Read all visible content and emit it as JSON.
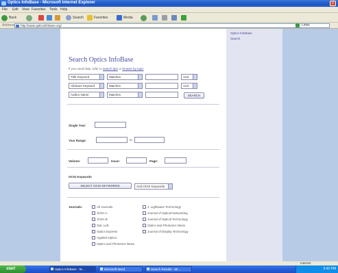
{
  "window": {
    "title": "Optics InfoBase - Microsoft Internet Explorer",
    "close_glyph": "x"
  },
  "menu": [
    "File",
    "Edit",
    "View",
    "Favorites",
    "Tools",
    "Help"
  ],
  "toolbar": {
    "back": "Back",
    "search": "Search",
    "favorites": "Favorites",
    "media": "Media"
  },
  "address": {
    "label": "Address",
    "url": "http://www.opticsinfobase.org/",
    "links": "Links"
  },
  "sidebar": {
    "items": [
      "Optics InfoBase",
      "Search"
    ]
  },
  "search": {
    "title": "Search Optics InfoBase",
    "intro_prefix": "If you need help, refer to ",
    "intro_link1": "search tips",
    "intro_mid": " or ",
    "intro_link2": "browse by topic",
    "rows": [
      {
        "field": "Title Keyword",
        "match": "Matches",
        "op": "And"
      },
      {
        "field": "Abstract Keyword",
        "match": "Matches",
        "op": "And"
      },
      {
        "field": "Author Name",
        "match": "Matches",
        "op": ""
      }
    ],
    "search_button": "SEARCH",
    "single_year_label": "Single Year:",
    "year_range_label": "Year Range:",
    "year_range_to": "to",
    "volume_label": "Volume:",
    "issue_label": "Issue:",
    "page_label": "Page:",
    "ocis_label": "OCIS Keywords",
    "ocis_button": "SELECT OCIS KEYWORDS",
    "ocis_select": "And OCIS Keywords",
    "journals_label": "Journals:",
    "journals_col1": [
      "All Journals",
      "JOSA A",
      "JOSA B",
      "Opt. Lett.",
      "Optics Express",
      "Applied Optics",
      "Optics and Photonics News"
    ],
    "journals_col2": [
      "J. Lightwave Technology",
      "Journal of Optical Networking",
      "Journal of Optical Technology",
      "Optics and Photonics News",
      "Journal of Display Technology"
    ]
  },
  "status": {
    "zone": "Internet"
  },
  "taskbar": {
    "start": "start",
    "tasks": [
      "Optics InfoBase - M...",
      "Microsoft Word",
      "Search Results - Mi..."
    ],
    "clock": "3:42 PM"
  }
}
